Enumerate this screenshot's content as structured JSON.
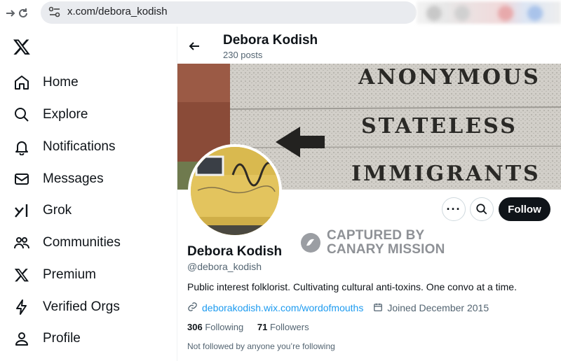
{
  "browser": {
    "url": "x.com/debora_kodish"
  },
  "sidebar": {
    "items": [
      {
        "label": "Home",
        "icon": "home-icon"
      },
      {
        "label": "Explore",
        "icon": "search-icon"
      },
      {
        "label": "Notifications",
        "icon": "bell-icon"
      },
      {
        "label": "Messages",
        "icon": "envelope-icon"
      },
      {
        "label": "Grok",
        "icon": "grok-icon"
      },
      {
        "label": "Communities",
        "icon": "people-icon"
      },
      {
        "label": "Premium",
        "icon": "x-logo-icon"
      },
      {
        "label": "Verified Orgs",
        "icon": "lightning-icon"
      },
      {
        "label": "Profile",
        "icon": "person-icon"
      }
    ]
  },
  "header": {
    "name": "Debora Kodish",
    "posts": "230 posts"
  },
  "banner": {
    "lines": [
      "ANONYMOUS",
      "STATELESS",
      "IMMIGRANTS"
    ]
  },
  "actions": {
    "follow_label": "Follow"
  },
  "watermark": {
    "line1": "CAPTURED BY",
    "line2": "CANARY MISSION"
  },
  "profile": {
    "name": "Debora Kodish",
    "handle": "@debora_kodish",
    "bio": "Public interest folklorist. Cultivating cultural anti-toxins. One convo at a time.",
    "link": "deborakodish.wix.com/wordofmouths",
    "joined": "Joined December 2015",
    "following_count": "306",
    "following_label": "Following",
    "followers_count": "71",
    "followers_label": "Followers",
    "not_followed": "Not followed by anyone you’re following"
  },
  "colors": {
    "accent": "#1d9bf0",
    "text": "#0f1419",
    "muted": "#536471",
    "follow_bg": "#0f1419"
  }
}
